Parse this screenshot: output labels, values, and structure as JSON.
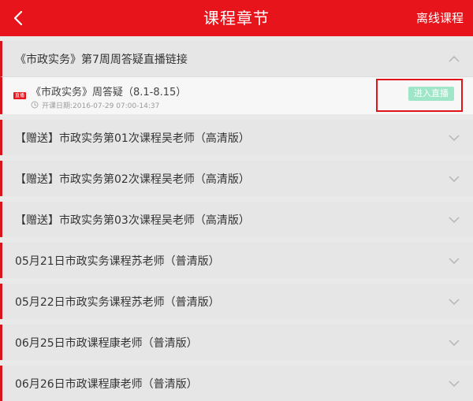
{
  "header": {
    "title": "课程章节",
    "right_action": "离线课程"
  },
  "chapters": [
    {
      "label": "《市政实务》第7周周答疑直播链接",
      "expanded": true,
      "lesson": {
        "badge": "直播",
        "title": "《市政实务》周答疑（8.1-8.15）",
        "date": "开课日期:2016-07-29 07:00-14:37",
        "button": "进入直播"
      }
    },
    {
      "label": "【赠送】市政实务第01次课程吴老师（高清版）",
      "expanded": false
    },
    {
      "label": "【赠送】市政实务第02次课程吴老师（高清版）",
      "expanded": false
    },
    {
      "label": "【赠送】市政实务第03次课程吴老师（高清版）",
      "expanded": false
    },
    {
      "label": "05月21日市政实务课程苏老师（普清版）",
      "expanded": false
    },
    {
      "label": "05月22日市政实务课程苏老师（普清版）",
      "expanded": false
    },
    {
      "label": "06月25日市政课程康老师（普清版）",
      "expanded": false
    },
    {
      "label": "06月26日市政课程康老师（普清版）",
      "expanded": false
    }
  ],
  "colors": {
    "accent": "#e8141b",
    "live_button": "#9fe6c8"
  }
}
